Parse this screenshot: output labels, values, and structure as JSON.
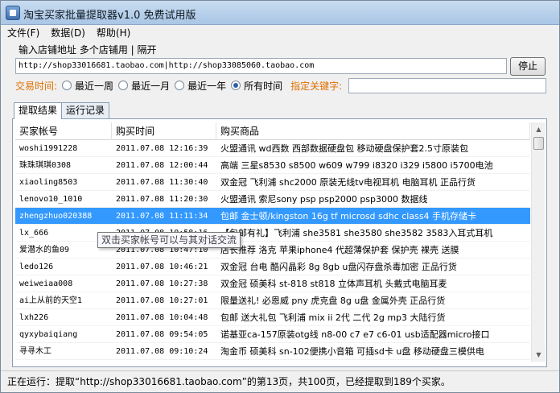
{
  "window": {
    "title": "淘宝买家批量提取器v1.0 免费试用版"
  },
  "menu": [
    {
      "label": "文件(F)"
    },
    {
      "label": "数据(D)"
    },
    {
      "label": "帮助(H)"
    }
  ],
  "input": {
    "label": "输入店铺地址  多个店铺用 | 隔开",
    "url_value": "http://shop33016681.taobao.com|http://shop33085060.taobao.com",
    "stop_label": "停止"
  },
  "filter": {
    "time_label": "交易时间:",
    "options": [
      {
        "label": "最近一周",
        "checked": false
      },
      {
        "label": "最近一月",
        "checked": false
      },
      {
        "label": "最近一年",
        "checked": false
      },
      {
        "label": "所有时间",
        "checked": true
      }
    ],
    "keyword_label": "指定关键字:",
    "keyword_value": ""
  },
  "tabs": [
    {
      "label": "提取结果",
      "active": true
    },
    {
      "label": "运行记录",
      "active": false
    }
  ],
  "table": {
    "headers": [
      "买家帐号",
      "购买时间",
      "购买商品"
    ],
    "rows": [
      {
        "buyer": "woshi1991228",
        "time": "2011.07.08 12:16:39",
        "item": "火盟通讯 wd西数 西部数据硬盘包 移动硬盘保护套2.5寸原装包",
        "selected": false
      },
      {
        "buyer": "珠珠琪琪0308",
        "time": "2011.07.08 12:00:44",
        "item": "高端 三星s8530 s8500 w609 w799 i8320 i329 i5800 i5700电池",
        "selected": false
      },
      {
        "buyer": "xiaoling8503",
        "time": "2011.07.08 11:30:40",
        "item": "双金冠 飞利浦 shc2000 原装无线tv电视耳机 电脑耳机 正品行货",
        "selected": false
      },
      {
        "buyer": "lenovo10_1010",
        "time": "2011.07.08 11:20:30",
        "item": "火盟通讯 索尼sony psp psp2000 psp3000 数据线",
        "selected": false
      },
      {
        "buyer": "zhengzhuo020388",
        "time": "2011.07.08 11:11:34",
        "item": "包邮 金士顿/kingston 16g tf microsd sdhc class4 手机存储卡",
        "selected": true
      },
      {
        "buyer": "lx_666",
        "time": "2011.07.08 10:58:16",
        "item": "【包邮有礼】飞利浦 she3581 she3580 she3582 3583入耳式耳机",
        "selected": false
      },
      {
        "buyer": "爱潜水的鱼09",
        "time": "2011.07.08 10:47:10",
        "item": "店长推荐 洛克 苹果iphone4 代超薄保护套 保护壳 裸壳 送膜",
        "selected": false
      },
      {
        "buyer": "ledo126",
        "time": "2011.07.08 10:46:21",
        "item": "双金冠 台电 酷闪晶彩 8g 8gb u盘闪存盘杀毒加密 正品行货",
        "selected": false
      },
      {
        "buyer": "weiweiaa008",
        "time": "2011.07.08 10:27:38",
        "item": "双金冠 硕美科 st-818 st818 立体声耳机 头戴式电脑耳麦",
        "selected": false
      },
      {
        "buyer": "ai上从前的天空1",
        "time": "2011.07.08 10:27:01",
        "item": "限量送礼! 必恩威 pny 虎克盘 8g u盘 金属外壳 正品行货",
        "selected": false
      },
      {
        "buyer": "lxh226",
        "time": "2011.07.08 10:04:48",
        "item": "包邮 送大礼包 飞利浦 mix ii 2代 二代 2g mp3 大陆行货",
        "selected": false
      },
      {
        "buyer": "qyxybaiqiang",
        "time": "2011.07.08 09:54:05",
        "item": "诺基亚ca-157原装otg线 n8-00 c7 e7 c6-01 usb适配器micro接口",
        "selected": false
      },
      {
        "buyer": "寻寻木工",
        "time": "2011.07.08 09:10:24",
        "item": "淘金币 硕美科 sn-102便携小音箱 可插sd卡 u盘 移动硬盘三模供电",
        "selected": false
      }
    ]
  },
  "tooltip": "双击买家帐号可以与其对话交流",
  "status": "正在运行：提取“http://shop33016681.taobao.com”的第13页，共100页，已经提取到189个买家。"
}
